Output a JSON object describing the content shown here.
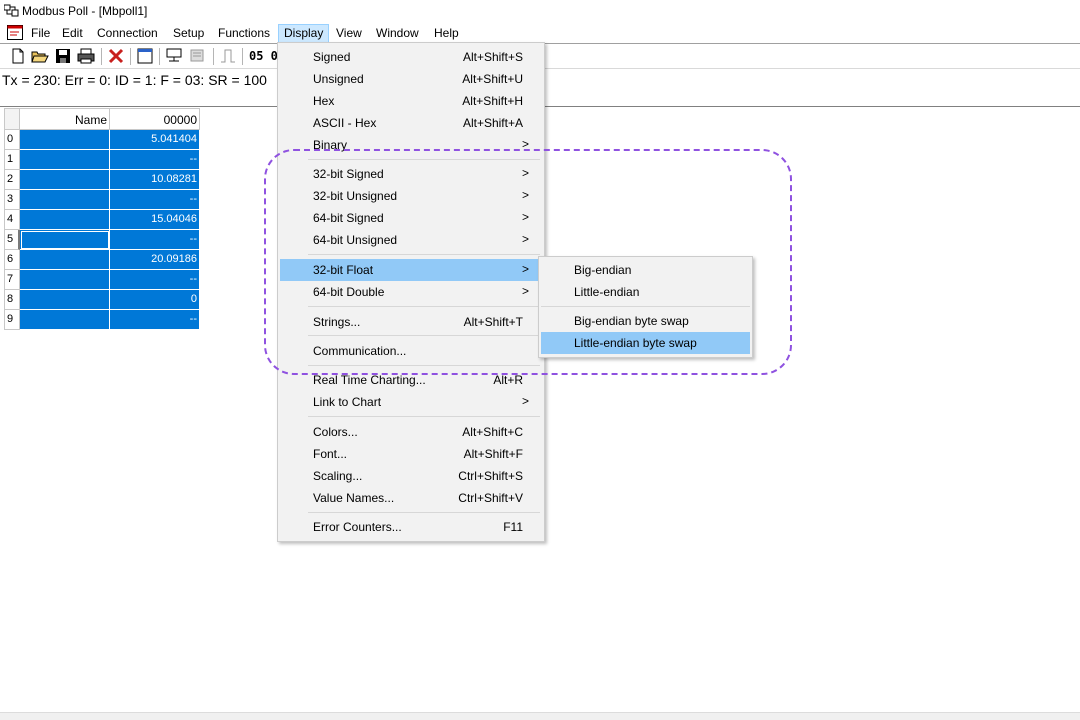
{
  "window": {
    "title": "Modbus Poll - [Mbpoll1]"
  },
  "menubar": {
    "items": [
      {
        "label": "File"
      },
      {
        "label": "Edit"
      },
      {
        "label": "Connection"
      },
      {
        "label": "Setup"
      },
      {
        "label": "Functions"
      },
      {
        "label": "Display"
      },
      {
        "label": "View"
      },
      {
        "label": "Window"
      },
      {
        "label": "Help"
      }
    ],
    "open_menu": "Display"
  },
  "toolbar": {
    "text_button": "05 0"
  },
  "status": {
    "text": "Tx = 230: Err = 0: ID = 1: F = 03: SR = 100"
  },
  "grid": {
    "columns": [
      "Name",
      "00000"
    ],
    "rows": [
      {
        "index": "0",
        "value": "5.041404"
      },
      {
        "index": "1",
        "value": "--"
      },
      {
        "index": "2",
        "value": "10.08281"
      },
      {
        "index": "3",
        "value": "--"
      },
      {
        "index": "4",
        "value": "15.04046"
      },
      {
        "index": "5",
        "value": "--"
      },
      {
        "index": "6",
        "value": "20.09186"
      },
      {
        "index": "7",
        "value": "--"
      },
      {
        "index": "8",
        "value": "0"
      },
      {
        "index": "9",
        "value": "--"
      }
    ]
  },
  "display_menu": {
    "items": [
      {
        "label": "Signed",
        "shortcut": "Alt+Shift+S"
      },
      {
        "label": "Unsigned",
        "shortcut": "Alt+Shift+U"
      },
      {
        "label": "Hex",
        "shortcut": "Alt+Shift+H"
      },
      {
        "label": "ASCII - Hex",
        "shortcut": "Alt+Shift+A"
      },
      {
        "label": "Binary",
        "arrow": ">"
      },
      {
        "label": "32-bit Signed",
        "arrow": ">"
      },
      {
        "label": "32-bit Unsigned",
        "arrow": ">"
      },
      {
        "label": "64-bit Signed",
        "arrow": ">"
      },
      {
        "label": "64-bit Unsigned",
        "arrow": ">"
      },
      {
        "label": "32-bit Float",
        "arrow": ">"
      },
      {
        "label": "64-bit Double",
        "arrow": ">"
      },
      {
        "label": "Strings...",
        "shortcut": "Alt+Shift+T"
      },
      {
        "label": "Communication..."
      },
      {
        "label": "Real Time Charting...",
        "shortcut": "Alt+R"
      },
      {
        "label": "Link to Chart",
        "arrow": ">"
      },
      {
        "label": "Colors...",
        "shortcut": "Alt+Shift+C"
      },
      {
        "label": "Font...",
        "shortcut": "Alt+Shift+F"
      },
      {
        "label": "Scaling...",
        "shortcut": "Ctrl+Shift+S"
      },
      {
        "label": "Value Names...",
        "shortcut": "Ctrl+Shift+V"
      },
      {
        "label": "Error Counters...",
        "shortcut": "F11"
      }
    ],
    "highlighted": "32-bit Float"
  },
  "float_submenu": {
    "items": [
      {
        "label": "Big-endian"
      },
      {
        "label": "Little-endian"
      },
      {
        "label": "Big-endian byte swap"
      },
      {
        "label": "Little-endian byte swap"
      }
    ],
    "highlighted": "Little-endian byte swap"
  },
  "colors": {
    "selection": "#0078d7",
    "menu_highlight": "#91c9f7",
    "annotation": "#8f52e0"
  }
}
